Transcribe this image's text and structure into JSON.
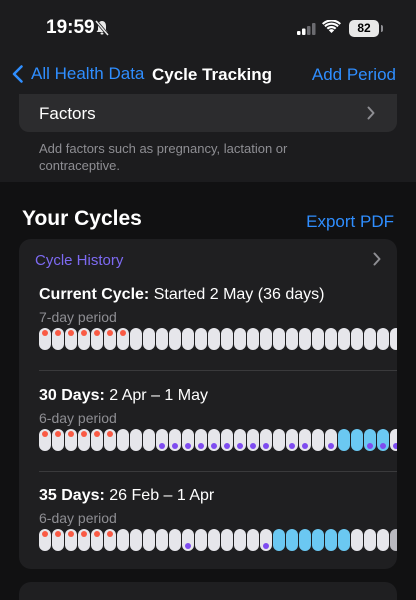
{
  "status_bar": {
    "time": "19:59",
    "battery": "82"
  },
  "nav": {
    "back_label": "All Health Data",
    "title": "Cycle Tracking",
    "action_label": "Add Period"
  },
  "factors": {
    "label": "Factors",
    "caption": "Add factors such as pregnancy, lactation or contraceptive."
  },
  "cycles": {
    "title": "Your Cycles",
    "export_label": "Export PDF",
    "history_header": "Cycle History",
    "rows": [
      {
        "heading_bold": "Current Cycle:",
        "heading_rest": " Started 2 May (36 days)",
        "subtitle": "7-day period"
      },
      {
        "heading_bold": "30 Days:",
        "heading_rest": " 2 Apr – 1 May",
        "subtitle": "6-day period"
      },
      {
        "heading_bold": "35 Days:",
        "heading_rest": " 26 Feb – 1 Apr",
        "subtitle": "6-day period"
      }
    ]
  },
  "colors": {
    "accent": "#2f8eff",
    "period_dot": "#fa5a44",
    "fertile": "#6bc8f2",
    "ovulation": "#7e4cf0",
    "history_header": "#7d6af2"
  }
}
